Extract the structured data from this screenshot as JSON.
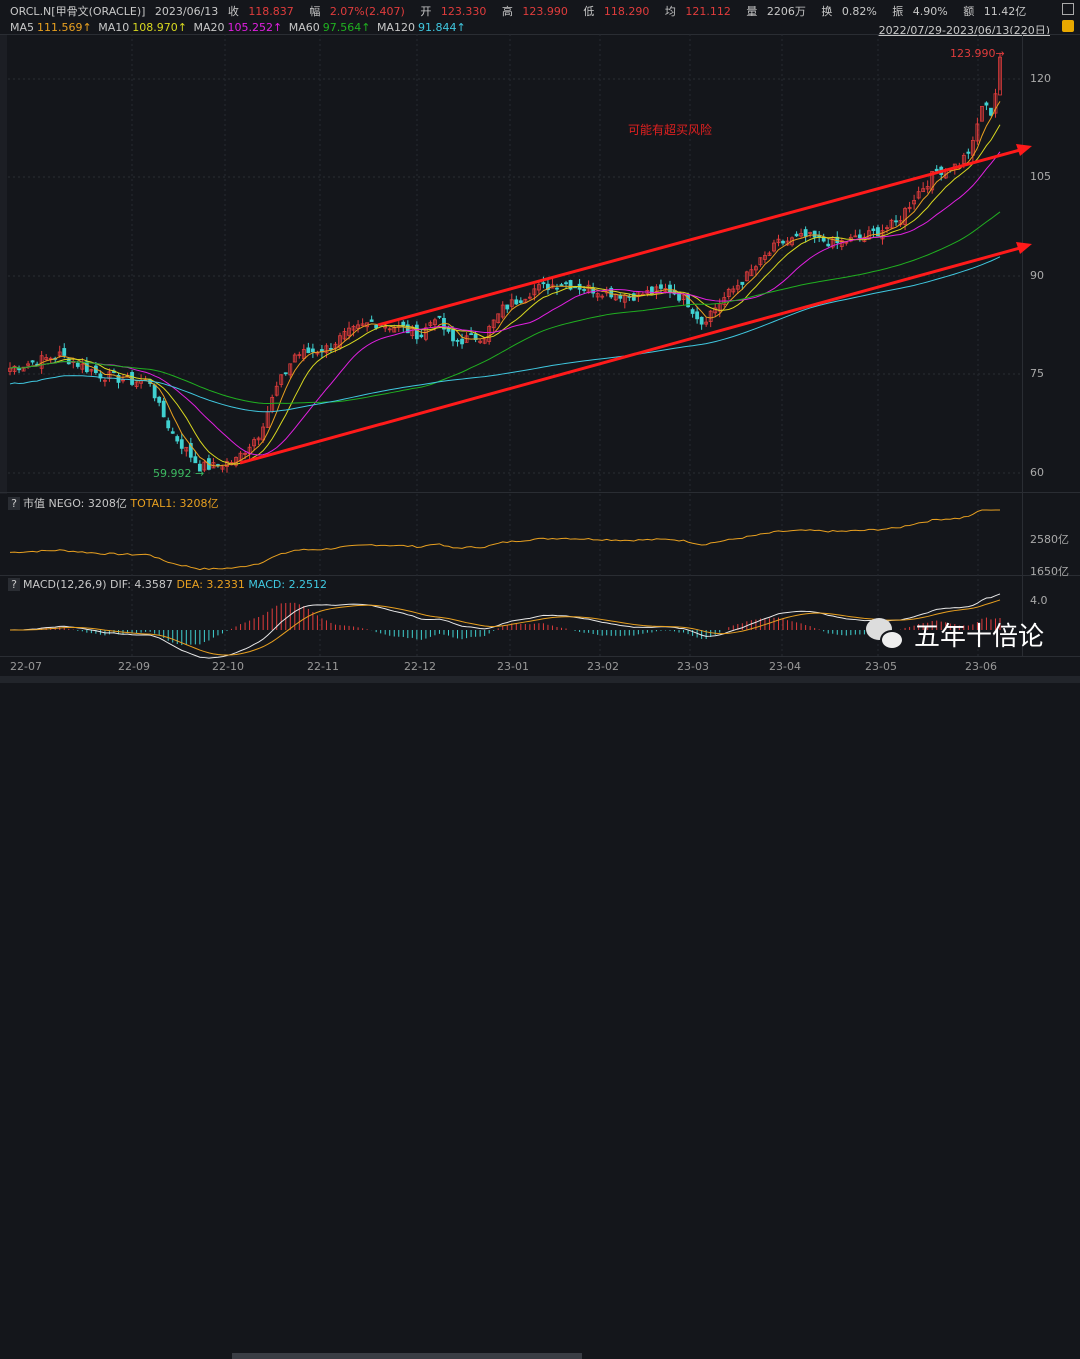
{
  "header": {
    "symbol": "ORCL.N[甲骨文(ORACLE)]",
    "date": "2023/06/13",
    "close_label": "收",
    "close": "118.837",
    "chg_label": "幅",
    "chg": "2.07%(2.407)",
    "open_label": "开",
    "open": "123.330",
    "high_label": "高",
    "high": "123.990",
    "low_label": "低",
    "low": "118.290",
    "avg_label": "均",
    "avg": "121.112",
    "vol_label": "量",
    "vol": "2206万",
    "turn_label": "换",
    "turn": "0.82%",
    "amp_label": "振",
    "amp": "4.90%",
    "amt_label": "额",
    "amt": "11.42亿"
  },
  "ma": {
    "ma5_label": "MA5",
    "ma5": "111.569↑",
    "ma10_label": "MA10",
    "ma10": "108.970↑",
    "ma20_label": "MA20",
    "ma20": "105.252↑",
    "ma60_label": "MA60",
    "ma60": "97.564↑",
    "ma120_label": "MA120",
    "ma120": "91.844↑"
  },
  "range": "2022/07/29-2023/06/13(220日)",
  "annotation": "可能有超买风险",
  "low_label": "59.992 →",
  "high_label": "123.990→",
  "price_axis": [
    "120",
    "105",
    "90",
    "75",
    "60"
  ],
  "mv": {
    "q": "?",
    "title": "市值",
    "nego": "NEGO: 3208亿",
    "total": "TOTAL1: 3208亿",
    "axis": [
      "2580亿",
      "1650亿"
    ]
  },
  "macd": {
    "q": "?",
    "title": "MACD(12,26,9)",
    "dif": "DIF: 4.3587",
    "dea": "DEA: 3.2331",
    "macd": "MACD: 2.2512",
    "axis": "4.0"
  },
  "dates": [
    "22-07",
    "22-09",
    "22-10",
    "22-11",
    "22-12",
    "23-01",
    "23-02",
    "23-03",
    "23-04",
    "23-05",
    "23-06"
  ],
  "watermark": "五年十倍论",
  "colors": {
    "up": "#e03c3c",
    "down": "#40d0d0",
    "ma5": "#e8a020",
    "ma10": "#d8d820",
    "ma20": "#e020e0",
    "ma60": "#20b020",
    "ma120": "#40c8e0",
    "trend": "#ff1a1a"
  },
  "chart_data": {
    "type": "candlestick",
    "days": 220,
    "anchors": [
      [
        0,
        76
      ],
      [
        11,
        78
      ],
      [
        20,
        75
      ],
      [
        27,
        74
      ],
      [
        31,
        74
      ],
      [
        33,
        70
      ],
      [
        36,
        66
      ],
      [
        42,
        61
      ],
      [
        45,
        61
      ],
      [
        50,
        62
      ],
      [
        55,
        66
      ],
      [
        59,
        73
      ],
      [
        63,
        78
      ],
      [
        70,
        79
      ],
      [
        74,
        81
      ],
      [
        80,
        83
      ],
      [
        87,
        82
      ],
      [
        91,
        81
      ],
      [
        94,
        84
      ],
      [
        98,
        80
      ],
      [
        105,
        81
      ],
      [
        109,
        85
      ],
      [
        116,
        88
      ],
      [
        122,
        89
      ],
      [
        129,
        88
      ],
      [
        137,
        87
      ],
      [
        146,
        88
      ],
      [
        150,
        86
      ],
      [
        153,
        83
      ],
      [
        157,
        86
      ],
      [
        163,
        90
      ],
      [
        170,
        95
      ],
      [
        176,
        96
      ],
      [
        183,
        95
      ],
      [
        189,
        96
      ],
      [
        196,
        98
      ],
      [
        200,
        102
      ],
      [
        205,
        106
      ],
      [
        210,
        107
      ],
      [
        213,
        110
      ],
      [
        215,
        116
      ],
      [
        217,
        115
      ],
      [
        219,
        121
      ]
    ],
    "ylim": [
      55,
      126
    ]
  }
}
